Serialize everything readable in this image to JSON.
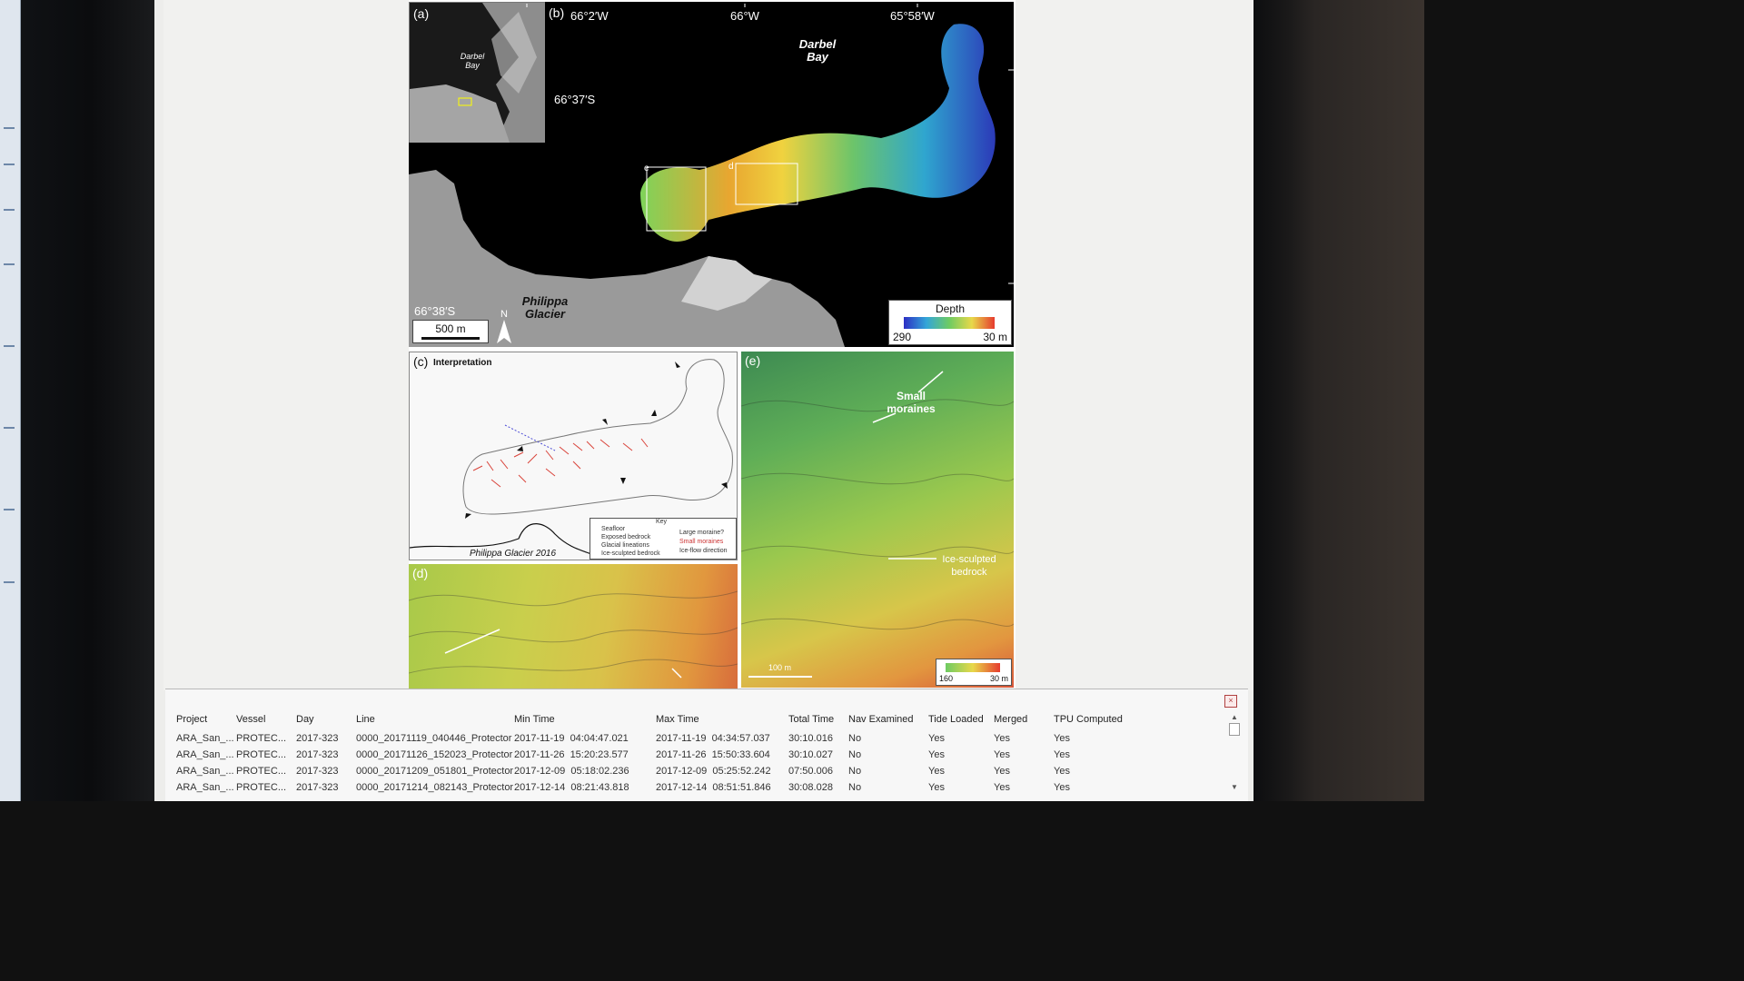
{
  "figure": {
    "panel_a": {
      "label": "(a)",
      "place": "Darbel Bay"
    },
    "panel_b": {
      "label": "(b)",
      "lon_ticks": [
        "66°2′W",
        "66°W",
        "65°58′W"
      ],
      "lat_ticks": [
        "66°37′S",
        "66°38′S"
      ],
      "places": {
        "darbel_bay": "Darbel Bay",
        "philippa_glacier": "Philippa Glacier"
      },
      "scale": "500 m",
      "north": "N",
      "box_labels": [
        "e",
        "d"
      ],
      "depth_legend": {
        "title": "Depth",
        "min": "290",
        "max": "30 m"
      }
    },
    "panel_c": {
      "label": "(c)",
      "title": "Interpretation",
      "glacier_line_label": "Philippa Glacier 2016",
      "key": {
        "title": "Key",
        "left": [
          "Seafloor",
          "Exposed bedrock",
          "Glacial lineations",
          "Ice-sculpted bedrock"
        ],
        "right": [
          "Large moraine?",
          "Small moraines",
          "Ice-flow direction"
        ]
      }
    },
    "panel_d": {
      "label": "(d)"
    },
    "panel_e": {
      "label": "(e)",
      "annotations": [
        "Small moraines",
        "Ice-sculpted bedrock"
      ],
      "scale": "100 m",
      "depth_legend": {
        "min": "160",
        "max": "30 m"
      }
    }
  },
  "table": {
    "close_icon": "close-icon",
    "headers": [
      "Project",
      "Vessel",
      "Day",
      "Line",
      "Min Time",
      "Max Time",
      "Total Time",
      "Nav Examined",
      "Tide Loaded",
      "Merged",
      "TPU Computed"
    ],
    "rows": [
      [
        "ARA_San_...",
        "PROTEC...",
        "2017-323",
        "0000_20171119_040446_Protector",
        "2017-11-19  04:04:47.021",
        "2017-11-19  04:34:57.037",
        "30:10.016",
        "No",
        "Yes",
        "Yes",
        "Yes"
      ],
      [
        "ARA_San_...",
        "PROTEC...",
        "2017-323",
        "0000_20171126_152023_Protector",
        "2017-11-26  15:20:23.577",
        "2017-11-26  15:50:33.604",
        "30:10.027",
        "No",
        "Yes",
        "Yes",
        "Yes"
      ],
      [
        "ARA_San_...",
        "PROTEC...",
        "2017-323",
        "0000_20171209_051801_Protector",
        "2017-12-09  05:18:02.236",
        "2017-12-09  05:25:52.242",
        "07:50.006",
        "No",
        "Yes",
        "Yes",
        "Yes"
      ],
      [
        "ARA_San_...",
        "PROTEC...",
        "2017-323",
        "0000_20171214_082143_Protector",
        "2017-12-14  08:21:43.818",
        "2017-12-14  08:51:51.846",
        "30:08.028",
        "No",
        "Yes",
        "Yes",
        "Yes"
      ]
    ]
  },
  "colors": {
    "depth_shallow": "#e63b2e",
    "depth_mid": "#e8d84a",
    "depth_deep": "#2c2fc4"
  }
}
